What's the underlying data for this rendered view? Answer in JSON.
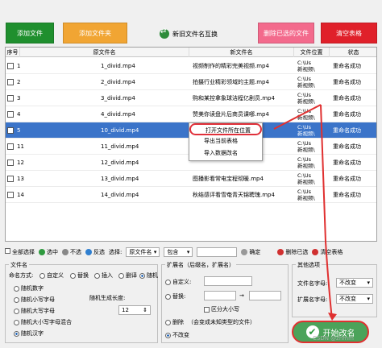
{
  "toolbar": {
    "add_file": "添加文件",
    "add_folder": "添加文件夹",
    "compare": "新旧文件名互换",
    "delete_done": "删除已选的文件",
    "clear_table": "清空表格"
  },
  "columns": [
    "序号",
    "原文件名",
    "新文件名",
    "文件位置",
    "状态"
  ],
  "rows": [
    {
      "num": "1",
      "orig": "1_divid.mp4",
      "new": "视频制作的精彩完美视频.mp4",
      "loc1": "C:\\Us",
      "loc2": "新视频\\",
      "status": "重命名成功"
    },
    {
      "num": "2",
      "orig": "2_divid.mp4",
      "new": "拍摄行业精彩领域的主题.mp4",
      "loc1": "C:\\Us",
      "loc2": "新视频\\",
      "status": "重命名成功"
    },
    {
      "num": "3",
      "orig": "3_divid.mp4",
      "new": "购和某控拿象球洁程亿剧员.mp4",
      "loc1": "C:\\Us",
      "loc2": "新视频\\",
      "status": "重命名成功"
    },
    {
      "num": "4",
      "orig": "4_divid.mp4",
      "new": "赞美你读盘片后商员课哪.mp4",
      "loc1": "C:\\Us",
      "loc2": "新视频\\",
      "status": "重命名成功"
    },
    {
      "num": "5",
      "orig": "10_divid.mp4",
      "new": "",
      "loc1": "C:\\Us",
      "loc2": "新视频\\",
      "status": "重命名成功"
    },
    {
      "num": "11",
      "orig": "11_divid.mp4",
      "new": "",
      "loc1": "C:\\Us",
      "loc2": "新视频\\",
      "status": "重命名成功"
    },
    {
      "num": "12",
      "orig": "12_divid.mp4",
      "new": "",
      "loc1": "C:\\Us",
      "loc2": "新视频\\",
      "status": "重命名成功"
    },
    {
      "num": "13",
      "orig": "13_divid.mp4",
      "new": "图播影看常电宝程彻暖.mp4",
      "loc1": "C:\\Us",
      "loc2": "新视频\\",
      "status": "重命名成功"
    },
    {
      "num": "14",
      "orig": "14_divid.mp4",
      "new": "秋结感评看雪奄青天锦聘瑰.mp4",
      "loc1": "C:\\Us",
      "loc2": "新视频\\",
      "status": "重命名成功"
    }
  ],
  "context_menu": [
    "打开文件所在位置",
    "导出当前表格",
    "导入数据改名"
  ],
  "filter": {
    "select_all": "全部选择",
    "select": "选中",
    "deselect": "不选",
    "invert": "反选",
    "choose": "选择:",
    "field": "原文件名",
    "contains": "包含",
    "confirm": "确定",
    "delete_selected": "删除已选",
    "clear_table": "清空表格"
  },
  "filename_group": {
    "title": "文件名",
    "naming_label": "命名方式:",
    "options": [
      "自定义",
      "替换",
      "插入",
      "删译",
      "随机"
    ],
    "random_opts": [
      "随机数字",
      "随机小写字母",
      "随机大写字母",
      "随机大小写字母混合",
      "随机汉字"
    ],
    "length_label": "随机生成长度:",
    "length_value": "12"
  },
  "ext_group": {
    "title": "扩展名（后缀名，扩展名）",
    "custom": "自定义:",
    "replace": "替换:",
    "case": "区分大小写",
    "delete": "删除",
    "delete_note": "（会变成未知类型的文件）",
    "no_change": "不改变"
  },
  "other_group": {
    "title": "其他选项",
    "name_case_label": "文件名字母:",
    "name_case_value": "不改变",
    "ext_case_label": "扩展名字母:",
    "ext_case_value": "不改变"
  },
  "start_button": "开始改名",
  "watermark": "CSDN @zhmm"
}
